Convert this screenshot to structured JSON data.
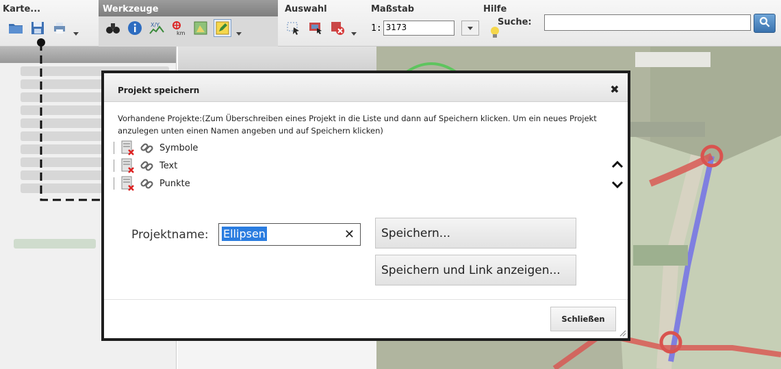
{
  "toolbar": {
    "groups": [
      {
        "title": "Karte...",
        "icons": [
          "open-folder-icon",
          "save-disk-icon",
          "print-icon"
        ]
      },
      {
        "title": "Werkzeuge",
        "icons": [
          "binoculars-icon",
          "info-icon",
          "xy-coordinates-icon",
          "measure-km-icon",
          "map-area-icon",
          "edit-drawing-icon"
        ]
      },
      {
        "title": "Auswahl",
        "icons": [
          "select-pointer-icon",
          "select-area-icon",
          "clear-selection-icon"
        ]
      },
      {
        "title": "Maßstab"
      },
      {
        "title": "Hilfe",
        "icons": [
          "help-lightbulb-icon"
        ]
      }
    ],
    "scale": {
      "prefix": "1:",
      "value": "3173"
    },
    "search": {
      "label": "Suche:",
      "value": ""
    }
  },
  "dialog": {
    "title": "Projekt speichern",
    "description": "Vorhandene Projekte:(Zum Überschreiben eines Projekt in die Liste und dann auf Speichern klicken. Um ein neues Projekt anzulegen unten einen Namen angeben und auf Speichern klicken)",
    "projects": [
      {
        "name": "Symbole"
      },
      {
        "name": "Text"
      },
      {
        "name": "Punkte"
      }
    ],
    "project_name_label": "Projektname:",
    "project_name_value": "Ellipsen",
    "save_label": "Speichern...",
    "save_link_label": "Speichern und Link anzeigen...",
    "close_label": "Schließen"
  },
  "colors": {
    "selection": "#2b7de0",
    "search_button": "#3a72ae",
    "route": "#d9534f",
    "path_blue": "#7f7fe0"
  }
}
